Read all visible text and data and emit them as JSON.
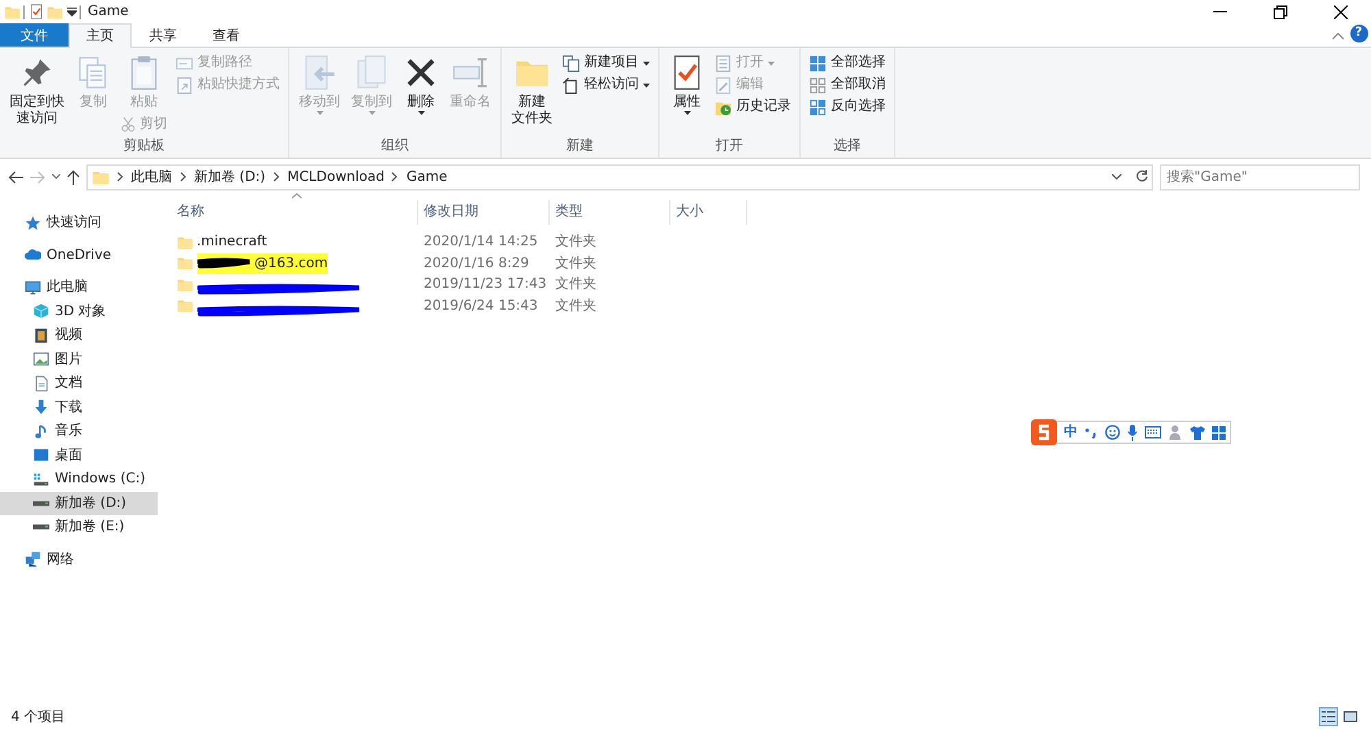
{
  "window": {
    "title": "Game"
  },
  "ribbon_tabs": [
    {
      "label": "文件",
      "kind": "file",
      "selected": false
    },
    {
      "label": "主页",
      "kind": "tab",
      "selected": true
    },
    {
      "label": "共享",
      "kind": "tab",
      "selected": false
    },
    {
      "label": "查看",
      "kind": "tab",
      "selected": false
    }
  ],
  "help": "?",
  "ribbon_groups": [
    {
      "label": "剪贴板",
      "items": [
        {
          "kind": "large",
          "lines": [
            "固定到快",
            "速访问"
          ],
          "disabled": false
        },
        {
          "kind": "large",
          "lines": [
            "复制"
          ],
          "disabled": true
        },
        {
          "kind": "large",
          "lines": [
            "粘贴"
          ],
          "disabled": true,
          "extra": {
            "label": "剪切",
            "disabled": true
          }
        },
        {
          "kind": "stack",
          "items": [
            {
              "label": "复制路径",
              "disabled": true
            },
            {
              "label": "粘贴快捷方式",
              "disabled": true
            }
          ]
        }
      ]
    },
    {
      "label": "组织",
      "items": [
        {
          "kind": "large",
          "lines": [
            "移动到"
          ],
          "disabled": true,
          "dropdown": true
        },
        {
          "kind": "large",
          "lines": [
            "复制到"
          ],
          "disabled": true,
          "dropdown": true
        },
        {
          "kind": "large",
          "lines": [
            "删除"
          ],
          "disabled": false,
          "dropdown": true
        },
        {
          "kind": "large",
          "lines": [
            "重命名"
          ],
          "disabled": true
        }
      ]
    },
    {
      "label": "新建",
      "items": [
        {
          "kind": "large",
          "lines": [
            "新建",
            "文件夹"
          ],
          "disabled": false
        },
        {
          "kind": "stack",
          "items": [
            {
              "label": "新建项目",
              "disabled": false,
              "dropdown": true
            },
            {
              "label": "轻松访问",
              "disabled": false,
              "dropdown": true
            }
          ]
        }
      ]
    },
    {
      "label": "打开",
      "items": [
        {
          "kind": "large",
          "lines": [
            "属性"
          ],
          "disabled": false,
          "dropdown": true
        },
        {
          "kind": "stack",
          "items": [
            {
              "label": "打开",
              "disabled": true,
              "dropdown": true
            },
            {
              "label": "编辑",
              "disabled": true
            },
            {
              "label": "历史记录",
              "disabled": false
            }
          ]
        }
      ]
    },
    {
      "label": "选择",
      "items": [
        {
          "kind": "stack",
          "items": [
            {
              "label": "全部选择",
              "disabled": false
            },
            {
              "label": "全部取消",
              "disabled": false
            },
            {
              "label": "反向选择",
              "disabled": false
            }
          ]
        }
      ]
    }
  ],
  "address": {
    "crumbs": [
      "此电脑",
      "新加卷 (D:)",
      "MCLDownload",
      "Game"
    ],
    "forward_disabled": true
  },
  "search": {
    "placeholder": "搜索\"Game\""
  },
  "nav": [
    {
      "label": "快速访问",
      "selected": false
    },
    {
      "label": "OneDrive",
      "selected": false
    },
    {
      "label": "此电脑",
      "selected": false,
      "children": [
        {
          "label": "3D 对象",
          "selected": false
        },
        {
          "label": "视频",
          "selected": false
        },
        {
          "label": "图片",
          "selected": false
        },
        {
          "label": "文档",
          "selected": false
        },
        {
          "label": "下载",
          "selected": false
        },
        {
          "label": "音乐",
          "selected": false
        },
        {
          "label": "桌面",
          "selected": false
        },
        {
          "label": "Windows (C:)",
          "selected": false
        },
        {
          "label": "新加卷 (D:)",
          "selected": true
        },
        {
          "label": "新加卷 (E:)",
          "selected": false
        }
      ]
    },
    {
      "label": "网络",
      "selected": false
    }
  ],
  "table": {
    "columns": [
      "名称",
      "修改日期",
      "类型",
      "大小"
    ],
    "rows": [
      {
        "name": ".minecraft",
        "modified": "2020/1/14 14:25",
        "type": "文件夹"
      },
      {
        "name": "@163.com",
        "modified": "2020/1/16 8:29",
        "type": "文件夹",
        "color": "#000000",
        "highlight": true
      },
      {
        "modified": "2019/11/23 17:43",
        "type": "文件夹",
        "color": "#0000ff"
      },
      {
        "modified": "2019/6/24 15:43",
        "type": "文件夹",
        "color": "#0000ff"
      }
    ]
  },
  "ime": {
    "mode": "中"
  },
  "status_bar": {
    "count": "4 个项目",
    "views": [
      {
        "kind": "details",
        "selected": true
      },
      {
        "kind": "large",
        "selected": false
      }
    ]
  }
}
